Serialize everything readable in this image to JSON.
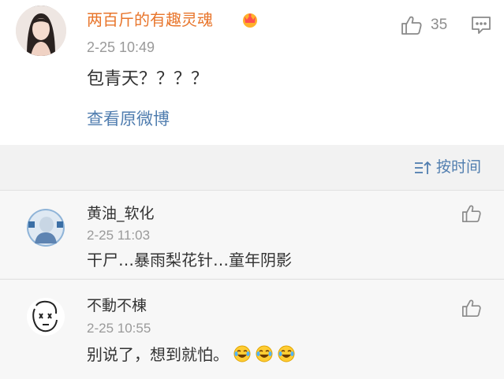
{
  "main_comment": {
    "username": "两百斤的有趣灵魂",
    "badge_icon": "crown-badge-icon",
    "timestamp": "2-25 10:49",
    "like_count": "35",
    "content": "包青天？？？？",
    "view_original_label": "查看原微博"
  },
  "sort": {
    "label": "按时间",
    "icon": "sort-icon"
  },
  "replies": [
    {
      "username": "黄油_软化",
      "timestamp": "2-25 11:03",
      "content": "干尸…暴雨梨花针…童年阴影"
    },
    {
      "username": "不動不棟",
      "timestamp": "2-25 10:55",
      "content": "别说了，想到就怕。",
      "emojis": [
        "laugh-cry-emoji",
        "laugh-cry-emoji",
        "laugh-cry-emoji"
      ]
    }
  ],
  "colors": {
    "username_orange": "#e8752b",
    "link_blue": "#507daf",
    "background": "#f2f2f2"
  }
}
